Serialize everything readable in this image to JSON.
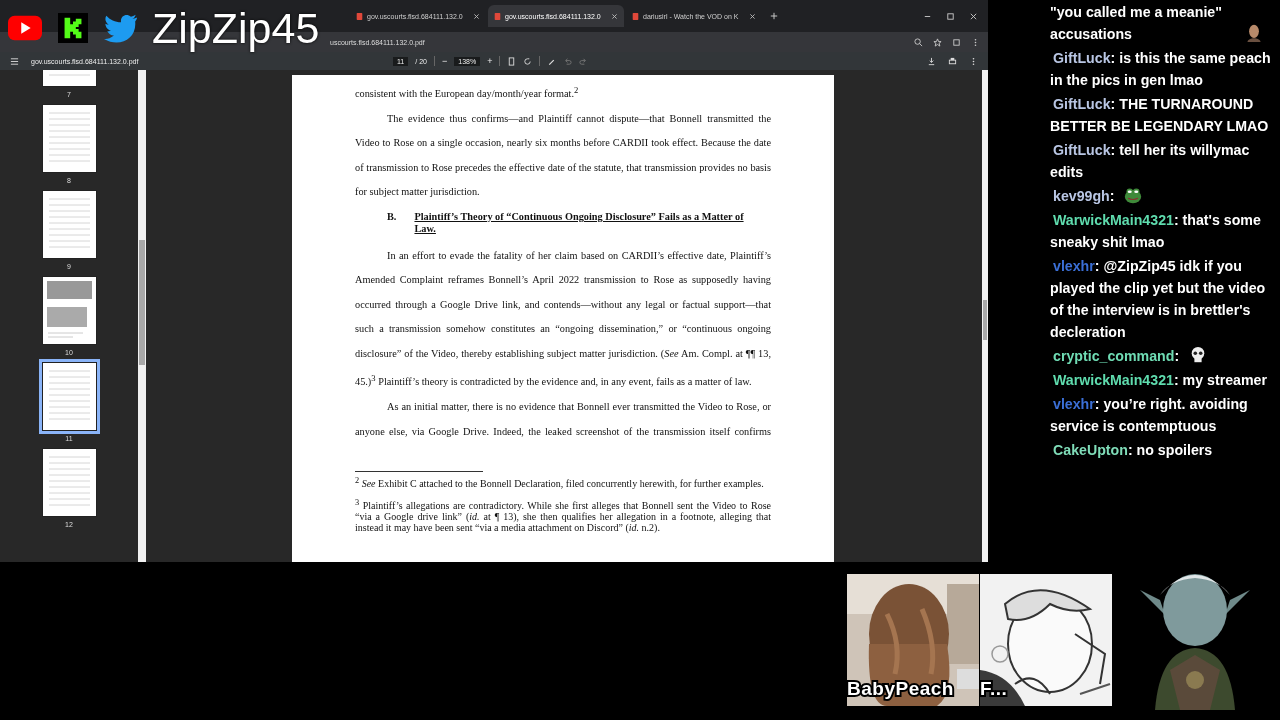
{
  "stream_overlay": {
    "channel_name": "ZipZip45"
  },
  "browser": {
    "tabs": [
      {
        "label": "gov.uscourts.flsd.684111.132.0",
        "selected": false
      },
      {
        "label": "gov.uscourts.flsd.684111.132.0",
        "selected": true
      },
      {
        "label": "dariusirl - Watch the VOD on K",
        "selected": false
      }
    ],
    "address": {
      "path": "uscourts.flsd.684111.132.0.pdf"
    }
  },
  "pdf_viewer": {
    "file_name": "gov.uscourts.flsd.684111.132.0.pdf",
    "page": "11",
    "page_count": "/ 20",
    "zoom": "138%",
    "minus": "−",
    "plus": "+",
    "thumbnails": [
      {
        "label": "7",
        "kind": "text",
        "selected": false
      },
      {
        "label": "8",
        "kind": "text",
        "selected": false
      },
      {
        "label": "9",
        "kind": "text",
        "selected": false
      },
      {
        "label": "10",
        "kind": "figure",
        "selected": false
      },
      {
        "label": "11",
        "kind": "text",
        "selected": true
      },
      {
        "label": "12",
        "kind": "text",
        "selected": false
      }
    ],
    "document": [
      {
        "kind": "continuation",
        "text": "consistent with the European day/month/year format.$^{2}$"
      },
      {
        "kind": "paragraph",
        "text": "The evidence thus confirms—and Plaintiff cannot dispute—that Bonnell transmitted the Video to Rose on a single occasion, nearly six months before CARDII took effect. Because the date of transmission to Rose precedes the effective date of the statute, that transmission provides no basis for subject matter jurisdiction."
      },
      {
        "kind": "heading",
        "number": "B.",
        "text": "Plaintiff’s Theory of “Continuous Ongoing Disclosure” Fails as a Matter of Law."
      },
      {
        "kind": "paragraph",
        "text": "In an effort to evade the fatality of her claim based on CARDII’s effective date, Plaintiff’s Amended Complaint reframes Bonnell’s April 2022 transmission to Rose as supposedly having occurred through a Google Drive link, and contends—without any legal or factual support—that such a transmission somehow constitutes an “ongoing dissemination,” or “continuous ongoing disclosure” of the Video, thereby establishing subject matter jurisdiction. (*See* Am. Compl. at ¶¶ 13, 45.)$^{3}$ Plaintiff’s theory is contradicted by the evidence and, in any event, fails as a matter of law."
      },
      {
        "kind": "paragraph_cut",
        "text": "As an initial matter, there is no evidence that Bonnell ever transmitted the Video to Rose, or anyone else, via Google Drive. Indeed, the leaked screenshot of the transmission itself confirms"
      }
    ],
    "footnotes": [
      "$^{2}$ *See* Exhibit C attached to the Bonnell Declaration, filed concurrently herewith, for further examples.",
      "$^{3}$ Plaintiff’s allegations are contradictory. While she first alleges that Bonnell sent the Video to Rose “via a Google drive link” (*id.* at ¶ 13), she then qualifies her allegation in a footnote, alleging that instead it may have been sent “via a media attachment on Discord” (*id.* n.2)."
    ]
  },
  "chat": [
    {
      "text": "\"you called me a meanie\" accusations",
      "kind": "face"
    },
    {
      "user": "GiftLuck",
      "color": "#b9c6e4",
      "text": ": is this the same peach in the pics in gen lmao"
    },
    {
      "user": "GiftLuck",
      "color": "#b9c6e4",
      "text": ": THE TURNAROUND BETTER BE LEGENDARY LMAO"
    },
    {
      "user": "GiftLuck",
      "color": "#b9c6e4",
      "text": ": tell her its willymac edits"
    },
    {
      "user": "kev99gh",
      "color": "#b9c6e4",
      "text": ":",
      "kind": "frog"
    },
    {
      "user": "WarwickMain4321",
      "color": "#5fdcae",
      "text": ": that's some sneaky shit lmao"
    },
    {
      "user": "vlexhr",
      "color": "#3b6fd6",
      "text": ": @ZipZip45 idk if you played the clip yet but the video of the interview is in brettler's decleration"
    },
    {
      "user": "cryptic_command",
      "color": "#6fdcb4",
      "text": ":",
      "kind": "skull"
    },
    {
      "user": "WarwickMain4321",
      "color": "#5fdcae",
      "text": ": my streamer"
    },
    {
      "user": "vlexhr",
      "color": "#3b6fd6",
      "text": ": you’re right. avoiding service is contemptuous"
    },
    {
      "user": "CakeUpton",
      "color": "#7fdcb8",
      "text": ": no spoilers"
    }
  ],
  "webcams": [
    {
      "label": "BabyPeach"
    },
    {
      "label": "F...",
      "kind": "sketch"
    }
  ]
}
